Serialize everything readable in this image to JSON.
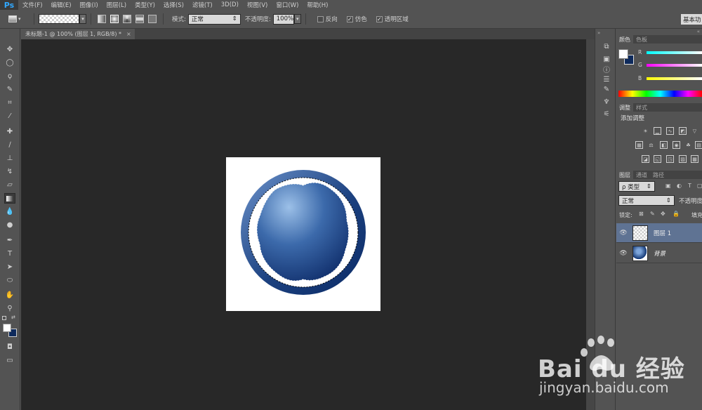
{
  "app": {
    "logo": "Ps"
  },
  "menu": [
    "文件(F)",
    "编辑(E)",
    "图像(I)",
    "图层(L)",
    "类型(Y)",
    "选择(S)",
    "滤镜(T)",
    "3D(D)",
    "视图(V)",
    "窗口(W)",
    "帮助(H)"
  ],
  "options": {
    "mode_label": "模式:",
    "mode_value": "正常",
    "opacity_label": "不透明度:",
    "opacity_value": "100%",
    "reverse_label": "反向",
    "dither_label": "仿色",
    "transparency_label": "透明区域",
    "workspace_label": "基本功",
    "dither_checked": true,
    "transparency_checked": true,
    "reverse_checked": false
  },
  "document": {
    "tab_label": "未标题-1 @ 100% (图层 1, RGB/8) *",
    "close": "×"
  },
  "panels": {
    "color_tab": "颜色",
    "swatches_tab": "色板",
    "r_label": "R",
    "g_label": "G",
    "b_label": "B",
    "adjust_tab": "调整",
    "styles_tab": "样式",
    "adjust_title": "添加调整",
    "layers_tab": "图层",
    "channels_tab": "通道",
    "paths_tab": "路径",
    "filter_kind": "ρ 类型",
    "blend_mode": "正常",
    "opacity_label": "不透明度",
    "lock_label": "锁定:",
    "fill_label": "填充"
  },
  "layers": [
    {
      "name": "图层 1",
      "selected": true
    },
    {
      "name": "背景",
      "selected": false
    }
  ],
  "colors": {
    "foreground": "#ffffff",
    "background": "#0e2a5c",
    "circle_outer_light": "#5b83c0",
    "circle_outer_dark": "#0a2a66",
    "circle_inner_light": "#8fb4e0",
    "circle_inner_dark": "#0f2d6a",
    "selection_bg": "#5f7393"
  },
  "watermark": {
    "brand": "Bai du 经验",
    "url": "jingyan.baidu.com"
  }
}
